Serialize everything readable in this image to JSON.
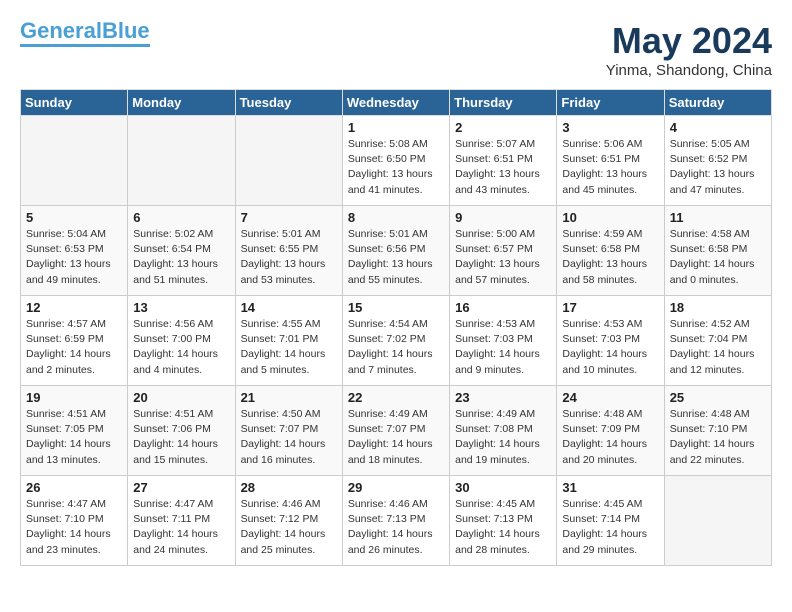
{
  "logo": {
    "line1": "General",
    "line2": "Blue"
  },
  "title": "May 2024",
  "location": "Yinma, Shandong, China",
  "days_of_week": [
    "Sunday",
    "Monday",
    "Tuesday",
    "Wednesday",
    "Thursday",
    "Friday",
    "Saturday"
  ],
  "weeks": [
    [
      {
        "day": "",
        "info": ""
      },
      {
        "day": "",
        "info": ""
      },
      {
        "day": "",
        "info": ""
      },
      {
        "day": "1",
        "info": "Sunrise: 5:08 AM\nSunset: 6:50 PM\nDaylight: 13 hours\nand 41 minutes."
      },
      {
        "day": "2",
        "info": "Sunrise: 5:07 AM\nSunset: 6:51 PM\nDaylight: 13 hours\nand 43 minutes."
      },
      {
        "day": "3",
        "info": "Sunrise: 5:06 AM\nSunset: 6:51 PM\nDaylight: 13 hours\nand 45 minutes."
      },
      {
        "day": "4",
        "info": "Sunrise: 5:05 AM\nSunset: 6:52 PM\nDaylight: 13 hours\nand 47 minutes."
      }
    ],
    [
      {
        "day": "5",
        "info": "Sunrise: 5:04 AM\nSunset: 6:53 PM\nDaylight: 13 hours\nand 49 minutes."
      },
      {
        "day": "6",
        "info": "Sunrise: 5:02 AM\nSunset: 6:54 PM\nDaylight: 13 hours\nand 51 minutes."
      },
      {
        "day": "7",
        "info": "Sunrise: 5:01 AM\nSunset: 6:55 PM\nDaylight: 13 hours\nand 53 minutes."
      },
      {
        "day": "8",
        "info": "Sunrise: 5:01 AM\nSunset: 6:56 PM\nDaylight: 13 hours\nand 55 minutes."
      },
      {
        "day": "9",
        "info": "Sunrise: 5:00 AM\nSunset: 6:57 PM\nDaylight: 13 hours\nand 57 minutes."
      },
      {
        "day": "10",
        "info": "Sunrise: 4:59 AM\nSunset: 6:58 PM\nDaylight: 13 hours\nand 58 minutes."
      },
      {
        "day": "11",
        "info": "Sunrise: 4:58 AM\nSunset: 6:58 PM\nDaylight: 14 hours\nand 0 minutes."
      }
    ],
    [
      {
        "day": "12",
        "info": "Sunrise: 4:57 AM\nSunset: 6:59 PM\nDaylight: 14 hours\nand 2 minutes."
      },
      {
        "day": "13",
        "info": "Sunrise: 4:56 AM\nSunset: 7:00 PM\nDaylight: 14 hours\nand 4 minutes."
      },
      {
        "day": "14",
        "info": "Sunrise: 4:55 AM\nSunset: 7:01 PM\nDaylight: 14 hours\nand 5 minutes."
      },
      {
        "day": "15",
        "info": "Sunrise: 4:54 AM\nSunset: 7:02 PM\nDaylight: 14 hours\nand 7 minutes."
      },
      {
        "day": "16",
        "info": "Sunrise: 4:53 AM\nSunset: 7:03 PM\nDaylight: 14 hours\nand 9 minutes."
      },
      {
        "day": "17",
        "info": "Sunrise: 4:53 AM\nSunset: 7:03 PM\nDaylight: 14 hours\nand 10 minutes."
      },
      {
        "day": "18",
        "info": "Sunrise: 4:52 AM\nSunset: 7:04 PM\nDaylight: 14 hours\nand 12 minutes."
      }
    ],
    [
      {
        "day": "19",
        "info": "Sunrise: 4:51 AM\nSunset: 7:05 PM\nDaylight: 14 hours\nand 13 minutes."
      },
      {
        "day": "20",
        "info": "Sunrise: 4:51 AM\nSunset: 7:06 PM\nDaylight: 14 hours\nand 15 minutes."
      },
      {
        "day": "21",
        "info": "Sunrise: 4:50 AM\nSunset: 7:07 PM\nDaylight: 14 hours\nand 16 minutes."
      },
      {
        "day": "22",
        "info": "Sunrise: 4:49 AM\nSunset: 7:07 PM\nDaylight: 14 hours\nand 18 minutes."
      },
      {
        "day": "23",
        "info": "Sunrise: 4:49 AM\nSunset: 7:08 PM\nDaylight: 14 hours\nand 19 minutes."
      },
      {
        "day": "24",
        "info": "Sunrise: 4:48 AM\nSunset: 7:09 PM\nDaylight: 14 hours\nand 20 minutes."
      },
      {
        "day": "25",
        "info": "Sunrise: 4:48 AM\nSunset: 7:10 PM\nDaylight: 14 hours\nand 22 minutes."
      }
    ],
    [
      {
        "day": "26",
        "info": "Sunrise: 4:47 AM\nSunset: 7:10 PM\nDaylight: 14 hours\nand 23 minutes."
      },
      {
        "day": "27",
        "info": "Sunrise: 4:47 AM\nSunset: 7:11 PM\nDaylight: 14 hours\nand 24 minutes."
      },
      {
        "day": "28",
        "info": "Sunrise: 4:46 AM\nSunset: 7:12 PM\nDaylight: 14 hours\nand 25 minutes."
      },
      {
        "day": "29",
        "info": "Sunrise: 4:46 AM\nSunset: 7:13 PM\nDaylight: 14 hours\nand 26 minutes."
      },
      {
        "day": "30",
        "info": "Sunrise: 4:45 AM\nSunset: 7:13 PM\nDaylight: 14 hours\nand 28 minutes."
      },
      {
        "day": "31",
        "info": "Sunrise: 4:45 AM\nSunset: 7:14 PM\nDaylight: 14 hours\nand 29 minutes."
      },
      {
        "day": "",
        "info": ""
      }
    ]
  ]
}
